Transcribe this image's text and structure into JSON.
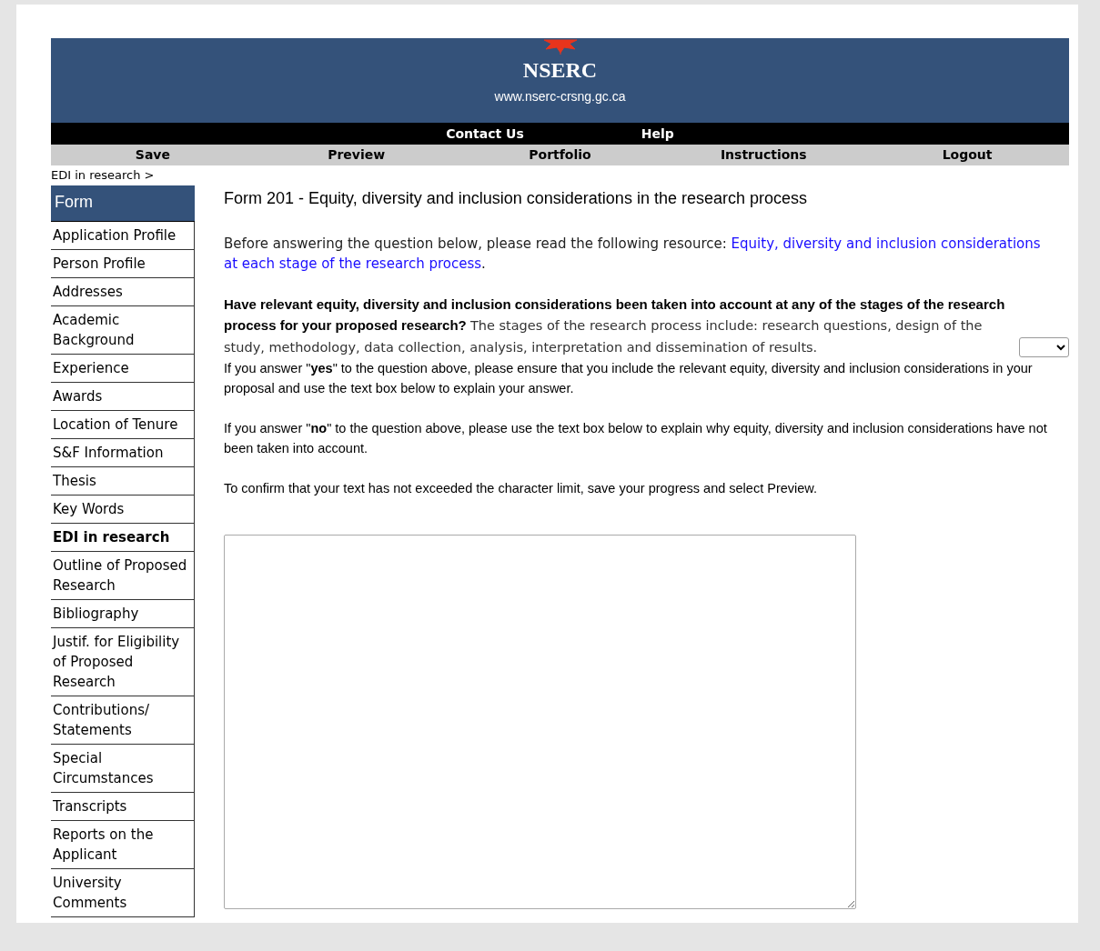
{
  "header": {
    "title": "NSERC",
    "url": "www.nserc-crsng.gc.ca"
  },
  "top_links": [
    "Contact Us",
    "Help"
  ],
  "nav": [
    "Save",
    "Preview",
    "Portfolio",
    "Instructions",
    "Logout"
  ],
  "breadcrumb": "EDI in research >",
  "sidebar": {
    "title": "Form",
    "items": [
      {
        "label": "Application Profile",
        "selected": false
      },
      {
        "label": "Person Profile",
        "selected": false
      },
      {
        "label": "Addresses",
        "selected": false
      },
      {
        "label": "Academic Background",
        "selected": false
      },
      {
        "label": "Experience",
        "selected": false
      },
      {
        "label": "Awards",
        "selected": false
      },
      {
        "label": "Location of Tenure",
        "selected": false
      },
      {
        "label": "S&F Information",
        "selected": false
      },
      {
        "label": "Thesis",
        "selected": false
      },
      {
        "label": "Key Words",
        "selected": false
      },
      {
        "label": "EDI in research",
        "selected": true
      },
      {
        "label": "Outline of Proposed Research",
        "selected": false
      },
      {
        "label": "Bibliography",
        "selected": false
      },
      {
        "label": "Justif. for Eligibility of Proposed Research",
        "selected": false
      },
      {
        "label": "Contributions/ Statements",
        "selected": false
      },
      {
        "label": "Special Circumstances",
        "selected": false
      },
      {
        "label": "Transcripts",
        "selected": false
      },
      {
        "label": "Reports on the Applicant",
        "selected": false
      },
      {
        "label": "University Comments",
        "selected": false
      }
    ]
  },
  "main": {
    "title": "Form 201 - Equity, diversity and inclusion considerations in the research process",
    "intro": {
      "text": "Before answering the question below, please read the following resource:",
      "link_lines": [
        "Equity, diversity and inclusion considerations",
        "at each stage of the research process"
      ],
      "after": "."
    },
    "question": {
      "bold": "Have relevant equity, diversity and inclusion considerations been taken into account at any of the stages of the research process for your proposed research?",
      "text": "The stages of the research process include: research questions, design of the study, methodology, data collection, analysis, interpretation and dissemination of results."
    },
    "notes": [
      "If you answer \"**yes**\" to the question above, please ensure that you include the relevant equity, diversity and inclusion considerations in your proposal and use the text box below to explain your answer.",
      "If you answer \"**no**\" to the question above, please use the text box below to explain why equity, diversity and inclusion considerations have not been taken into account.",
      "To confirm that your text has not exceeded the character limit, save your progress and select Preview."
    ]
  }
}
